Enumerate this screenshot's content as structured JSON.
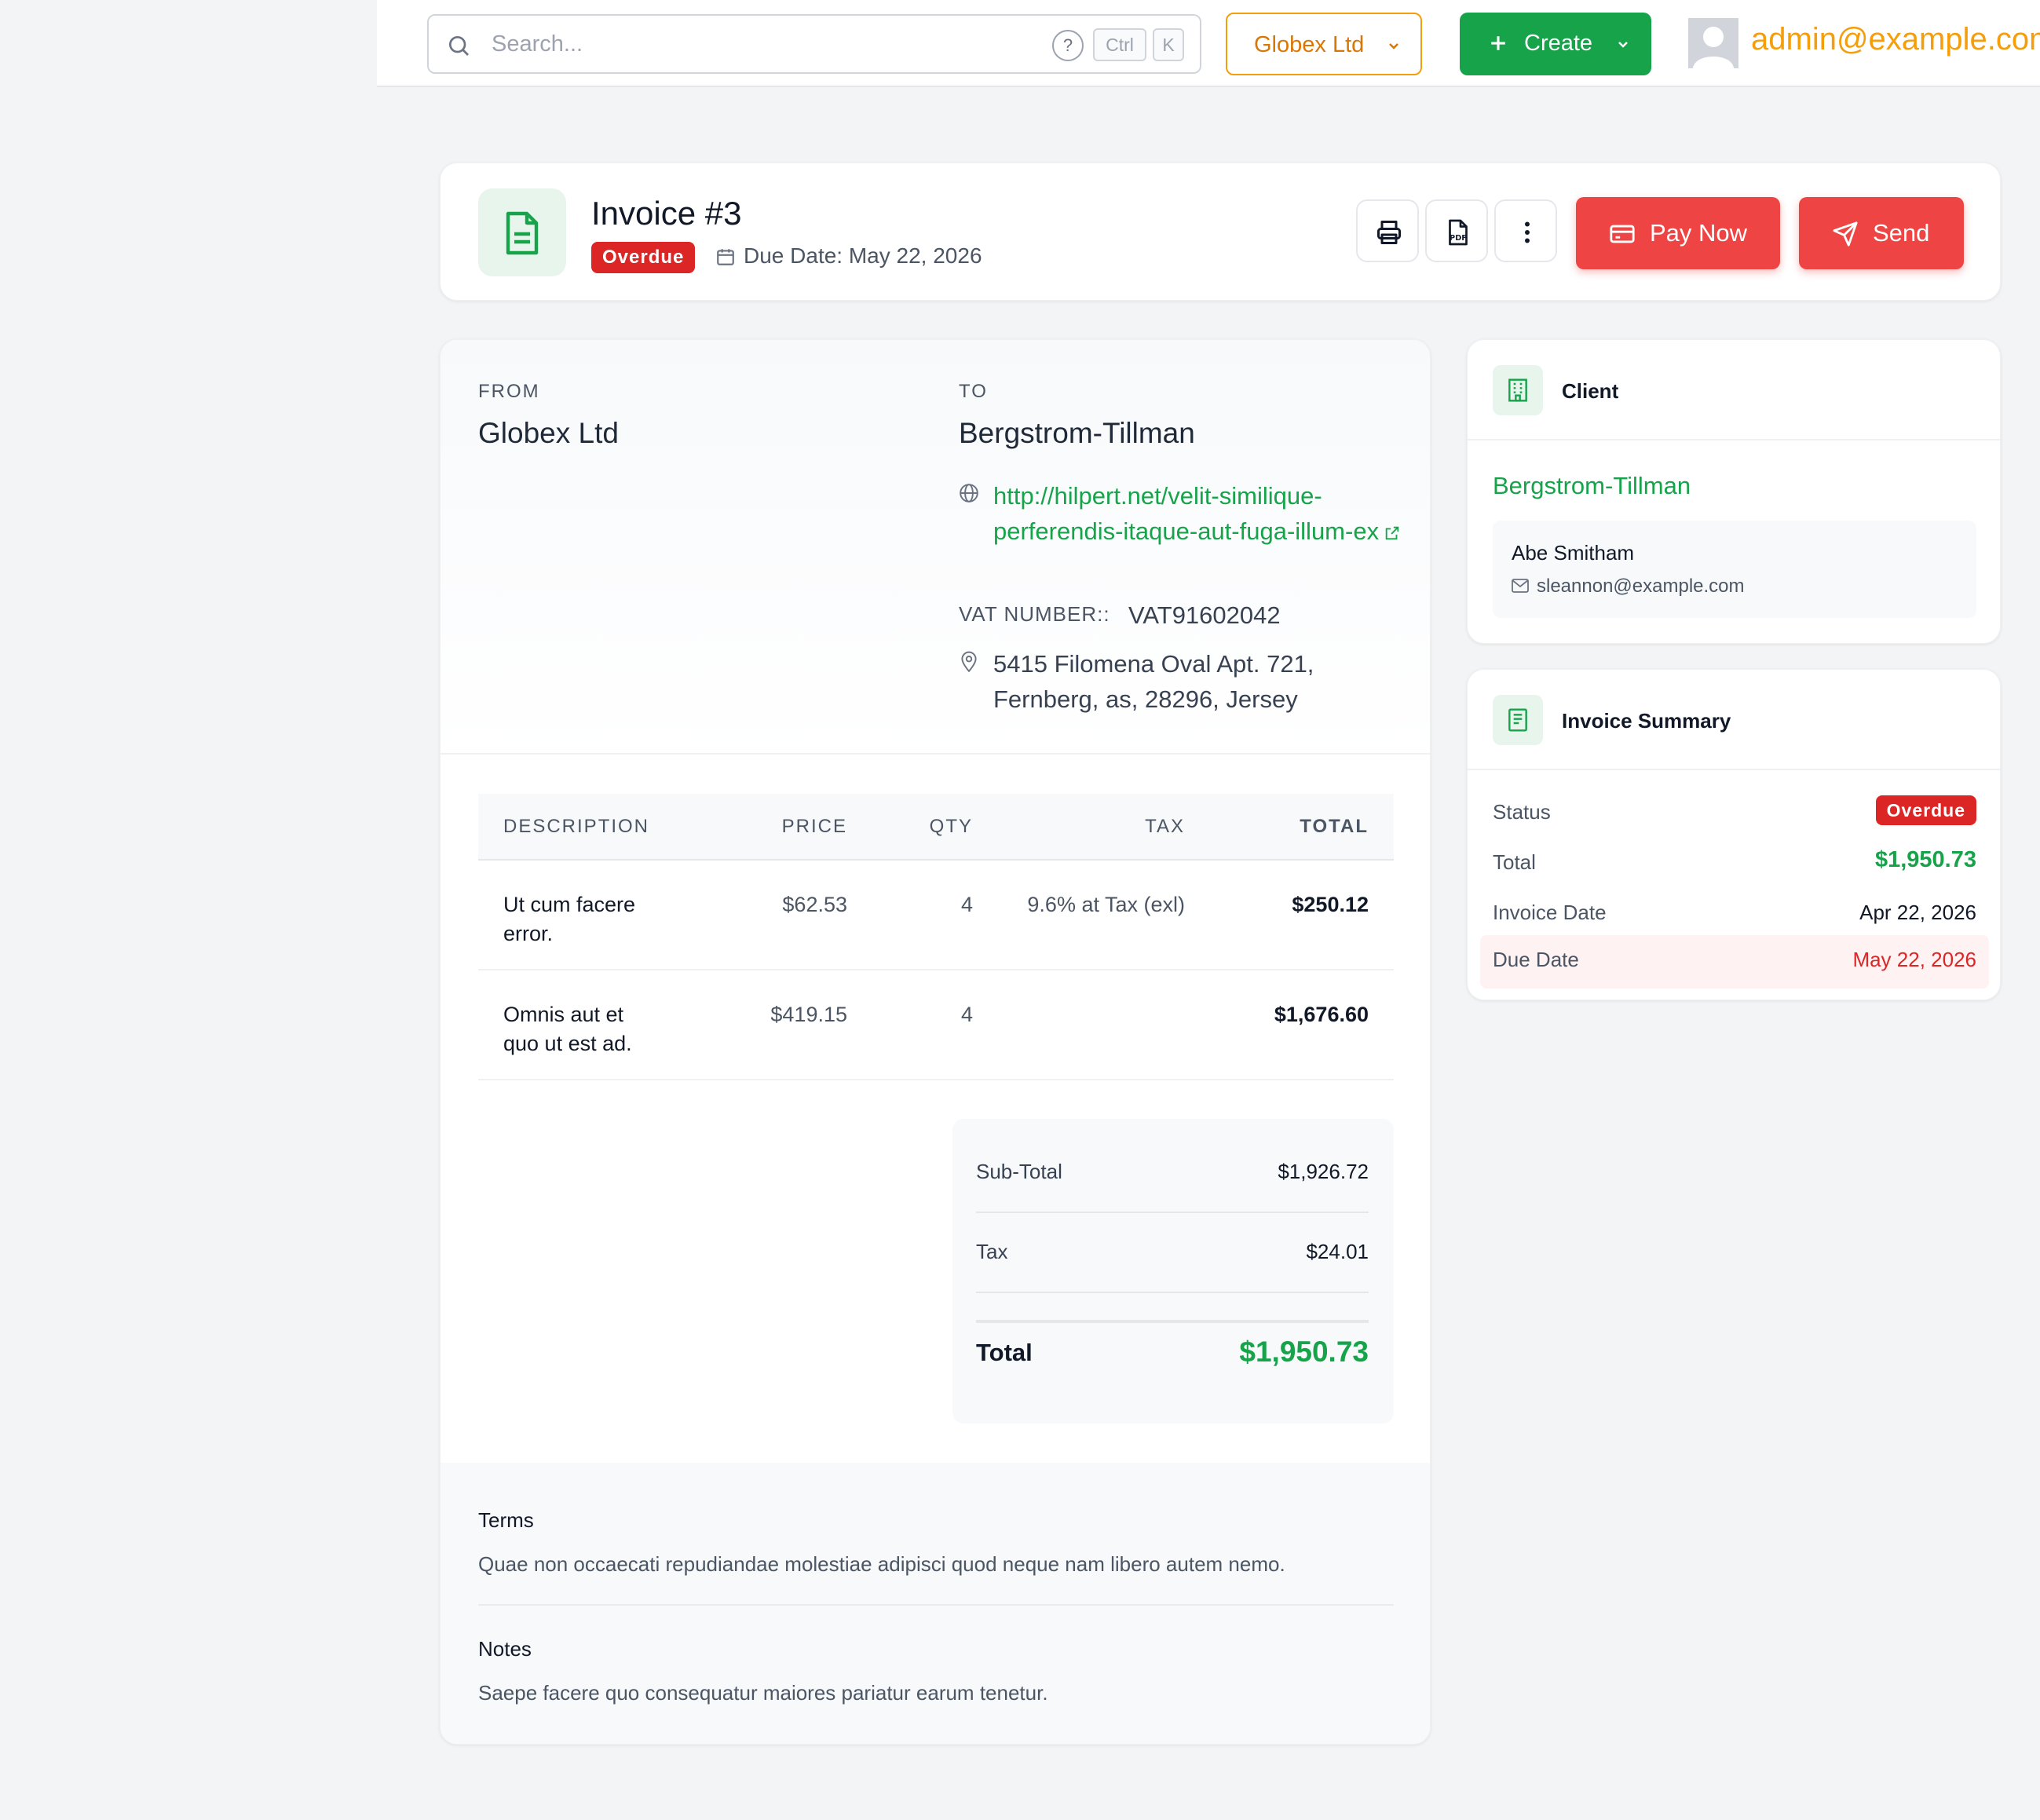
{
  "topbar": {
    "search_placeholder": "Search...",
    "help_glyph": "?",
    "kbd_ctrl": "Ctrl",
    "kbd_k": "K",
    "org_label": "Globex Ltd",
    "create_label": "Create",
    "user_email": "admin@example.com"
  },
  "header": {
    "title": "Invoice #3",
    "status": "Overdue",
    "due_date_text": "Due Date: May 22, 2026",
    "pay_label": "Pay Now",
    "send_label": "Send"
  },
  "invoice": {
    "from_label": "FROM",
    "from_name": "Globex Ltd",
    "to_label": "TO",
    "to_name": "Bergstrom-Tillman",
    "to_url": "http://hilpert.net/velit-similique-perferendis-itaque-aut-fuga-illum-ex",
    "vat_label": "VAT NUMBER::",
    "vat_value": "VAT91602042",
    "address": "5415 Filomena Oval Apt. 721, Fernberg, as, 28296, Jersey",
    "columns": {
      "description": "DESCRIPTION",
      "price": "PRICE",
      "qty": "QTY",
      "tax": "TAX",
      "total": "TOTAL"
    },
    "items": [
      {
        "description": "Ut cum facere error.",
        "price": "$62.53",
        "qty": "4",
        "tax": "9.6% at Tax (exl)",
        "total": "$250.12"
      },
      {
        "description": "Omnis aut et quo ut est ad.",
        "price": "$419.15",
        "qty": "4",
        "tax": "",
        "total": "$1,676.60"
      }
    ],
    "totals": {
      "subtotal_label": "Sub-Total",
      "subtotal": "$1,926.72",
      "tax_label": "Tax",
      "tax": "$24.01",
      "total_label": "Total",
      "total": "$1,950.73"
    },
    "terms_label": "Terms",
    "terms_text": "Quae non occaecati repudiandae molestiae adipisci quod neque nam libero autem nemo.",
    "notes_label": "Notes",
    "notes_text": "Saepe facere quo consequatur maiores pariatur earum tenetur."
  },
  "client_card": {
    "title": "Client",
    "client_name": "Bergstrom-Tillman",
    "contact_name": "Abe Smitham",
    "contact_email": "sleannon@example.com"
  },
  "summary_card": {
    "title": "Invoice Summary",
    "status_label": "Status",
    "status": "Overdue",
    "total_label": "Total",
    "total": "$1,950.73",
    "invoice_date_label": "Invoice Date",
    "invoice_date": "Apr 22, 2026",
    "due_date_label": "Due Date",
    "due_date": "May 22, 2026"
  },
  "colors": {
    "primary_green": "#16a34a",
    "accent_orange": "#f59e0b",
    "danger_red": "#ef4444",
    "badge_red": "#dc2626"
  },
  "icons": [
    "search-icon",
    "help-icon",
    "chevron-down-icon",
    "plus-icon",
    "avatar",
    "document-icon",
    "calendar-icon",
    "printer-icon",
    "pdf-icon",
    "more-vertical-icon",
    "credit-card-icon",
    "send-icon",
    "globe-icon",
    "external-link-icon",
    "map-pin-icon",
    "building-icon",
    "receipt-icon",
    "mail-icon"
  ]
}
